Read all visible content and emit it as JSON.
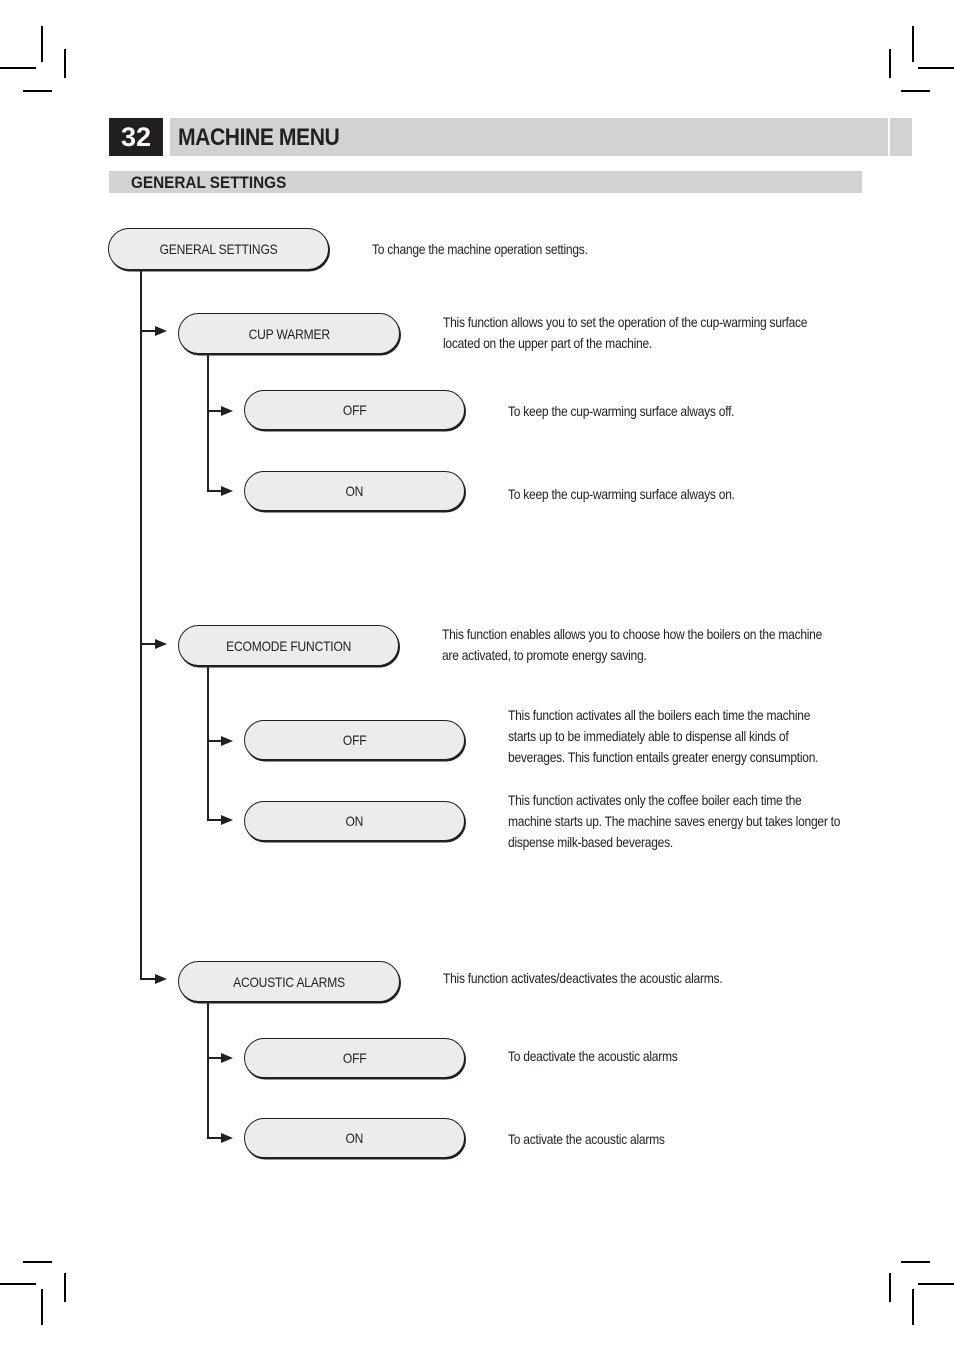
{
  "header": {
    "page_number": "32",
    "title": "MACHINE MENU"
  },
  "section": {
    "title": "GENERAL SETTINGS"
  },
  "menu": {
    "root": {
      "label": "GENERAL SETTINGS",
      "description": "To change the machine operation settings."
    },
    "items": [
      {
        "label": "CUP WARMER",
        "description": [
          "This function allows you to set the operation of the cup-warming surface",
          "located on the upper part of the machine."
        ],
        "options": [
          {
            "label": "OFF",
            "description": [
              "To keep the cup-warming surface always off."
            ]
          },
          {
            "label": "ON",
            "description": [
              "To keep the cup-warming surface always on."
            ]
          }
        ]
      },
      {
        "label": "ECOMODE FUNCTION",
        "description": [
          "This function enables allows you to choose how the boilers on the machine",
          "are activated, to promote energy saving."
        ],
        "options": [
          {
            "label": "OFF",
            "description": [
              "This function activates all the boilers each time the machine",
              "starts up to be immediately able to dispense all kinds of",
              "beverages. This function entails greater energy consumption."
            ]
          },
          {
            "label": "ON",
            "description": [
              "This function activates only the coffee boiler each time the",
              "machine starts up. The machine saves energy but takes longer to",
              "dispense milk-based beverages."
            ]
          }
        ]
      },
      {
        "label": "ACOUSTIC ALARMS",
        "description": [
          "This function activates/deactivates the acoustic alarms."
        ],
        "options": [
          {
            "label": "OFF",
            "description": [
              "To deactivate the acoustic alarms"
            ]
          },
          {
            "label": "ON",
            "description": [
              "To activate the acoustic alarms"
            ]
          }
        ]
      }
    ]
  }
}
